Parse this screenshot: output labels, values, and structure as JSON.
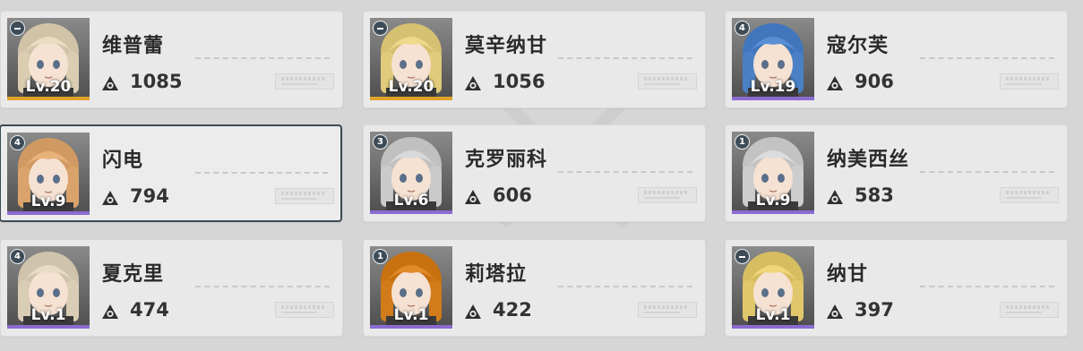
{
  "colors": {
    "rarity_gold": "#e0a32a",
    "rarity_purple": "#8b6bd2",
    "badge_bg": "#3e4c57",
    "selected_border": "#3a4a55"
  },
  "power_icon": "power-triangle-icon",
  "cards": [
    {
      "name": "维普蕾",
      "level": "Lv.20",
      "power": "1085",
      "badge": "minus",
      "rarity": "gold",
      "hair": "#e9dcc0",
      "selected": false
    },
    {
      "name": "莫辛纳甘",
      "level": "Lv.20",
      "power": "1056",
      "badge": "minus",
      "rarity": "gold",
      "hair": "#efd98a",
      "selected": false
    },
    {
      "name": "寇尔芙",
      "level": "Lv.19",
      "power": "906",
      "badge": "4",
      "rarity": "purple",
      "hair": "#5a8fd6",
      "selected": false
    },
    {
      "name": "闪电",
      "level": "Lv.9",
      "power": "794",
      "badge": "4",
      "rarity": "purple",
      "hair": "#e8b27a",
      "selected": true
    },
    {
      "name": "克罗丽科",
      "level": "Lv.6",
      "power": "606",
      "badge": "3",
      "rarity": "purple",
      "hair": "#d9d9d9",
      "selected": false
    },
    {
      "name": "纳美西丝",
      "level": "Lv.9",
      "power": "583",
      "badge": "1",
      "rarity": "purple",
      "hair": "#dcdcdc",
      "selected": false
    },
    {
      "name": "夏克里",
      "level": "Lv.1",
      "power": "474",
      "badge": "4",
      "rarity": "purple",
      "hair": "#e8dcc4",
      "selected": false
    },
    {
      "name": "莉塔拉",
      "level": "Lv.1",
      "power": "422",
      "badge": "1",
      "rarity": "purple",
      "hair": "#e08a2a",
      "selected": false
    },
    {
      "name": "纳甘",
      "level": "Lv.1",
      "power": "397",
      "badge": "minus",
      "rarity": "purple",
      "hair": "#f0d67a",
      "selected": false
    }
  ]
}
